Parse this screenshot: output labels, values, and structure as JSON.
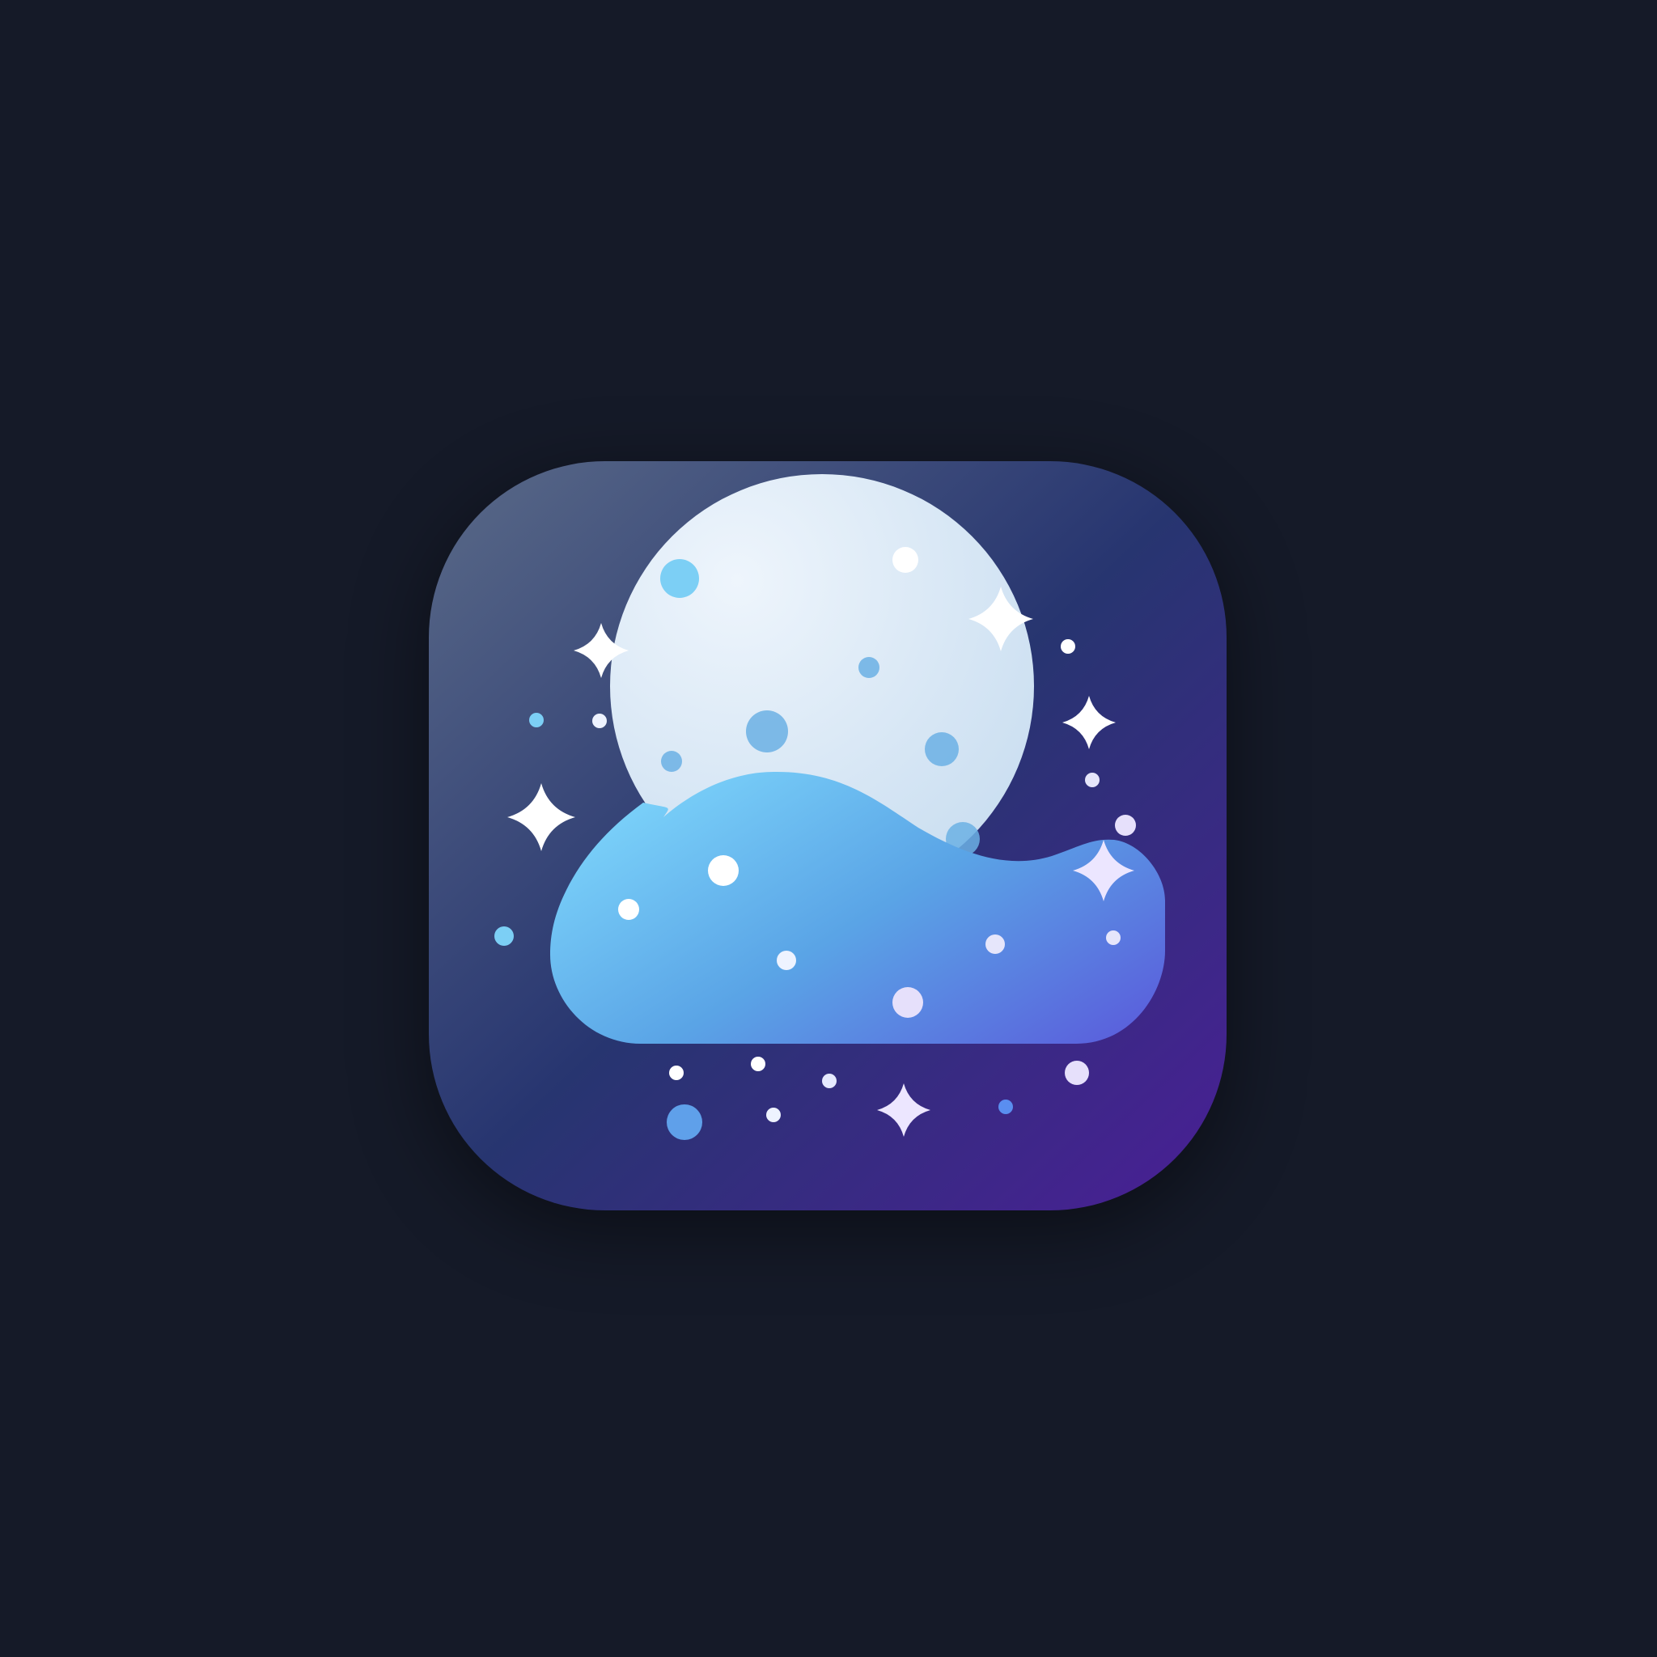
{
  "background_color": "#151a28",
  "app_icon": {
    "icon_name": "moon-cloud-stars-icon",
    "colors": {
      "tile_top_left": "#5a6a88",
      "tile_mid": "#273570",
      "tile_bottom_right": "#4a1f96",
      "moon_light": "#eef5fc",
      "moon_shade": "#c8ddf0",
      "moon_crater": "#6bb0e4",
      "cloud_light": "#7dd5fb",
      "cloud_mid": "#5aa4e6",
      "cloud_dark": "#5a5fdc",
      "star": "#ffffff",
      "dot_blue": "#7ccff5",
      "dot_lavender": "#e6e0fb"
    }
  }
}
